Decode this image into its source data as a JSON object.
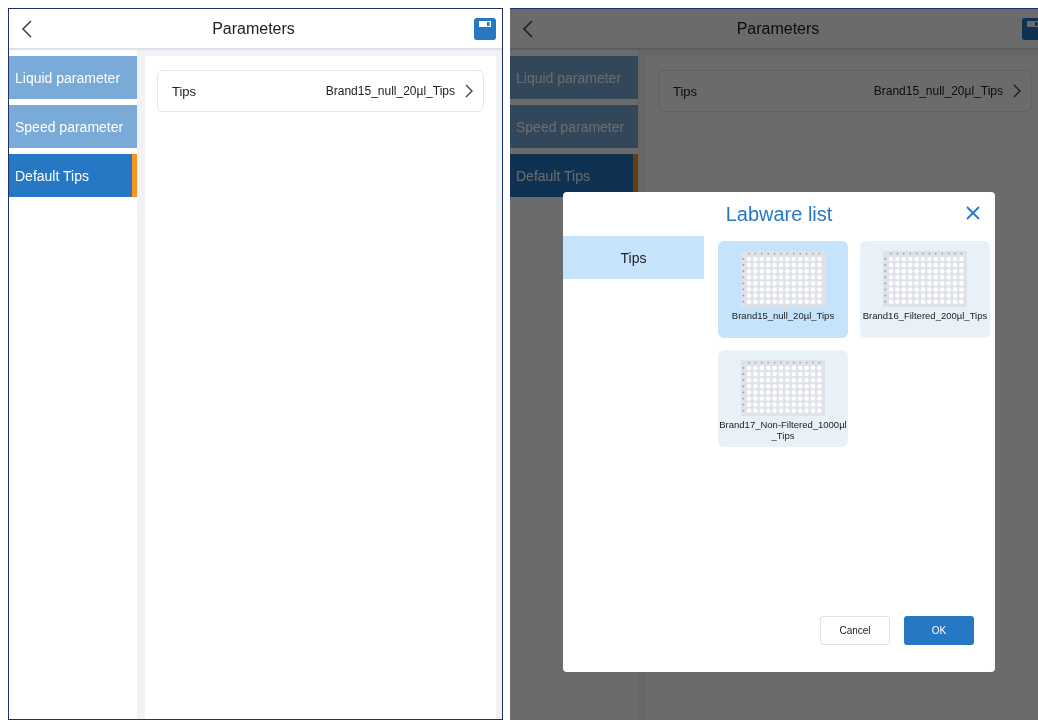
{
  "screens": [
    {
      "title": "Parameters",
      "dimmed": false,
      "sidebar": [
        {
          "label": "Liquid parameter",
          "selected": false
        },
        {
          "label": "Speed parameter",
          "selected": false
        },
        {
          "label": "Default Tips",
          "selected": true
        }
      ],
      "settings": [
        {
          "label": "Tips",
          "value": "Brand15_null_20µl_Tips"
        }
      ]
    },
    {
      "title": "Parameters",
      "dimmed": true,
      "sidebar": [
        {
          "label": "Liquid parameter",
          "selected": false
        },
        {
          "label": "Speed parameter",
          "selected": false
        },
        {
          "label": "Default Tips",
          "selected": true
        }
      ],
      "settings": [
        {
          "label": "Tips",
          "value": "Brand15_null_20µl_Tips"
        }
      ],
      "dialog": {
        "title": "Labware list",
        "categories": [
          {
            "label": "Tips",
            "selected": true
          }
        ],
        "items": [
          {
            "label": "Brand15_null_20µl_Tips",
            "selected": true
          },
          {
            "label": "Brand16_Filtered_200µl_Tips",
            "selected": false
          },
          {
            "label": "Brand17_Non-Filtered_1000µl_Tips",
            "selected": false
          }
        ],
        "buttons": [
          {
            "label": "Cancel",
            "kind": "secondary"
          },
          {
            "label": "OK",
            "kind": "primary"
          }
        ]
      }
    }
  ]
}
